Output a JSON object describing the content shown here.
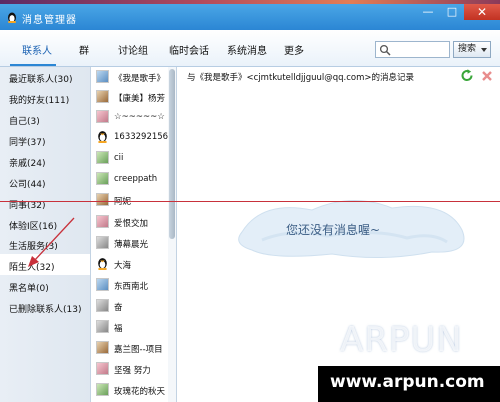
{
  "window": {
    "title": "消息管理器"
  },
  "tabs": [
    {
      "label": "联系人"
    },
    {
      "label": "群"
    },
    {
      "label": "讨论组"
    },
    {
      "label": "临时会话"
    },
    {
      "label": "系统消息"
    },
    {
      "label": "更多"
    }
  ],
  "search": {
    "placeholder": "",
    "button_label": "搜索"
  },
  "categories": [
    {
      "label": "最近联系人(30)"
    },
    {
      "label": "我的好友(111)"
    },
    {
      "label": "自己(3)"
    },
    {
      "label": "同学(37)"
    },
    {
      "label": "亲戚(24)"
    },
    {
      "label": "公司(44)"
    },
    {
      "label": "同事(32)"
    },
    {
      "label": "体验I区(16)"
    },
    {
      "label": "生活服务(3)"
    },
    {
      "label": "陌生人(32)"
    },
    {
      "label": "黑名单(0)"
    },
    {
      "label": "已删除联系人(13)"
    }
  ],
  "contacts": [
    {
      "name": "《我是歌手》"
    },
    {
      "name": "【康美】杨芳"
    },
    {
      "name": "☆~~~~~☆"
    },
    {
      "name": "1633292156"
    },
    {
      "name": "cii"
    },
    {
      "name": "creeppath"
    },
    {
      "name": "阿妮"
    },
    {
      "name": "爱恨交加"
    },
    {
      "name": "薄幕晨光"
    },
    {
      "name": "大海"
    },
    {
      "name": "东西南北"
    },
    {
      "name": "奋"
    },
    {
      "name": "福"
    },
    {
      "name": "嘉兰图--项目"
    },
    {
      "name": "坚强 努力"
    },
    {
      "name": "玫瑰花的秋天"
    }
  ],
  "record": {
    "title": "与《我是歌手》<cjmtkutelldjjguul@qq.com>的消息记录",
    "empty_text": "您还没有消息喔~"
  },
  "watermark": {
    "logo": "ARPUN",
    "url": "www.arpun.com"
  },
  "colors": {
    "accent": "#2b86d4",
    "annotation": "#c8313b"
  }
}
